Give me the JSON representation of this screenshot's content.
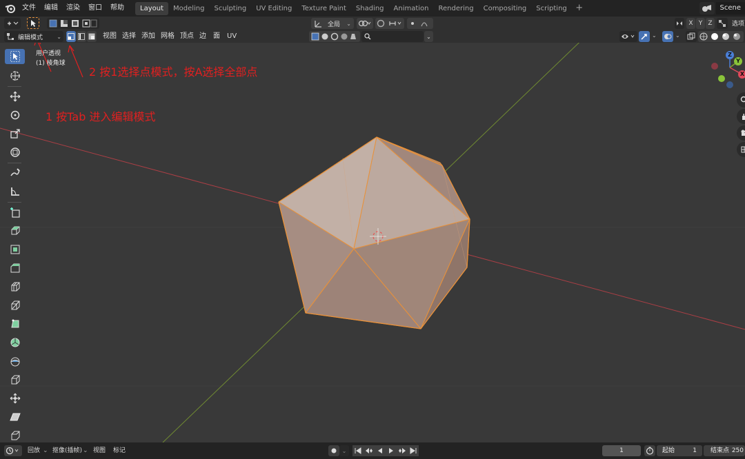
{
  "top_menu": [
    "文件",
    "编辑",
    "渲染",
    "窗口",
    "帮助"
  ],
  "workspace_tabs": [
    "Layout",
    "Modeling",
    "Sculpting",
    "UV Editing",
    "Texture Paint",
    "Shading",
    "Animation",
    "Rendering",
    "Compositing",
    "Scripting"
  ],
  "active_tab": "Layout",
  "add_tab_label": "+",
  "scene": {
    "name": "Scene",
    "view_layer_label": "选项"
  },
  "header": {
    "mode_label": "编辑模式",
    "menus": [
      "视图",
      "选择",
      "添加",
      "网格",
      "顶点",
      "边",
      "面",
      "UV"
    ],
    "transform_orientation": "全局",
    "axis_labels": [
      "X",
      "Y",
      "Z"
    ]
  },
  "viewport": {
    "view_name": "用户透视",
    "object_name": "(1) 棱角球",
    "gizmo_labels": {
      "z": "Z",
      "y": "Y",
      "x": "X"
    }
  },
  "annotations": {
    "step1": "1 按Tab 进入编辑模式",
    "step2": "2 按1选择点模式，按A选择全部点"
  },
  "timeline": {
    "playback": "回放",
    "keying": "抠像(插帧)",
    "view": "视图",
    "marker": "标记",
    "current_frame": "1",
    "start_label": "起始",
    "start_value": "1",
    "end_label": "结束点",
    "end_value": "250"
  },
  "colors": {
    "accent_blue": "#4772b3",
    "selection_orange": "#e8913a",
    "annotation_red": "#e02020",
    "axis_red": "#c84048",
    "axis_green": "#7a9a30"
  }
}
